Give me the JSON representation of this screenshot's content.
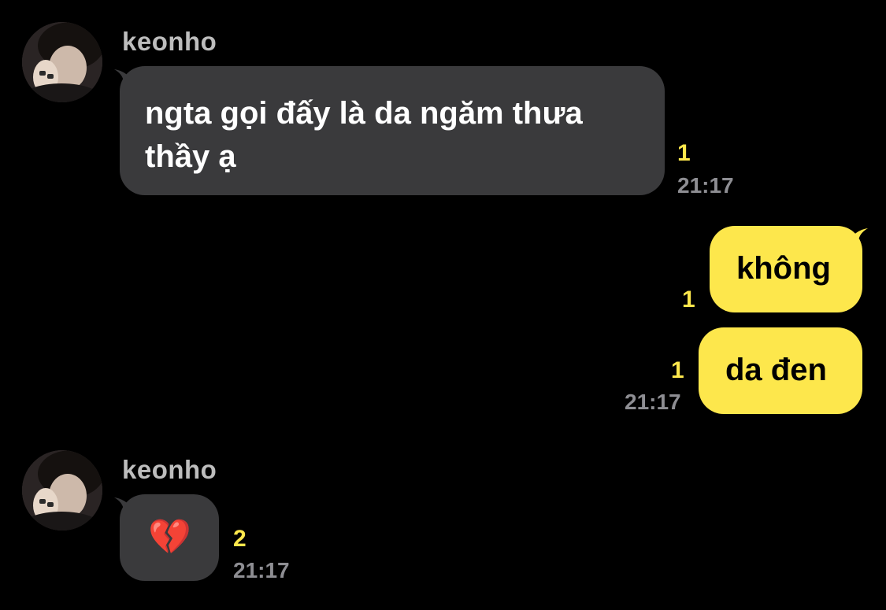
{
  "messages": [
    {
      "sender": "keonho",
      "text_line1": "ngta gọi đấy là da ngăm thưa",
      "text_line2": "thầy ạ",
      "unread": "1",
      "time": "21:17"
    },
    {
      "text": "không",
      "unread": "1"
    },
    {
      "text": "da đen",
      "unread": "1",
      "time": "21:17"
    },
    {
      "sender": "keonho",
      "text": "💔",
      "unread": "2",
      "time": "21:17"
    }
  ],
  "colors": {
    "background": "#000000",
    "incoming_bubble": "#3a3a3c",
    "outgoing_bubble": "#fde74c",
    "unread_count": "#fde74c",
    "timestamp": "#8e8e93",
    "sender_name": "#bdbdbd"
  }
}
